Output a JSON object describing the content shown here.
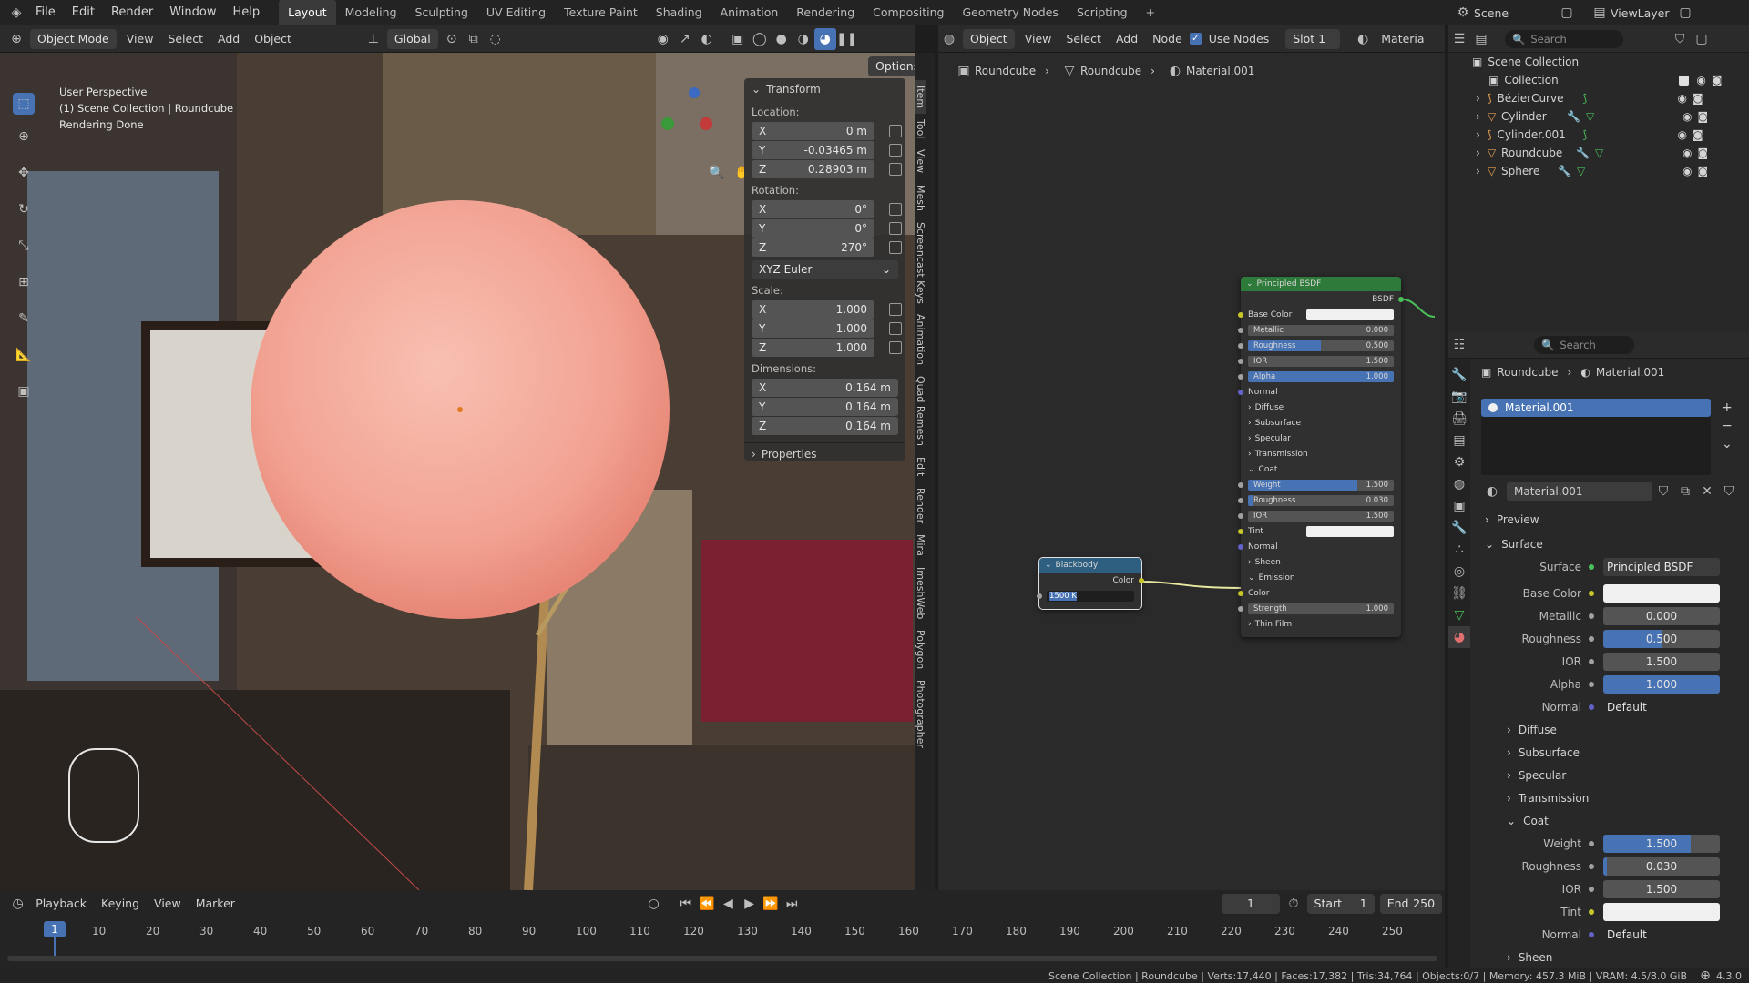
{
  "topbar": {
    "menus": [
      "File",
      "Edit",
      "Render",
      "Window",
      "Help"
    ],
    "workspaces": [
      "Layout",
      "Modeling",
      "Sculpting",
      "UV Editing",
      "Texture Paint",
      "Shading",
      "Animation",
      "Rendering",
      "Compositing",
      "Geometry Nodes",
      "Scripting"
    ],
    "active_workspace": "Layout",
    "scene": "Scene",
    "view_layer": "ViewLayer"
  },
  "viewport_header": {
    "mode": "Object Mode",
    "menus": [
      "View",
      "Select",
      "Add",
      "Object"
    ],
    "orientation": "Global",
    "options": "Options"
  },
  "viewport_overlay": {
    "line1": "User Perspective",
    "line2": "(1) Scene Collection | Roundcube",
    "line3": "Rendering Done"
  },
  "npanel": {
    "title": "Transform",
    "location_label": "Location:",
    "location": [
      {
        "axis": "X",
        "value": "0 m"
      },
      {
        "axis": "Y",
        "value": "-0.03465 m"
      },
      {
        "axis": "Z",
        "value": "0.28903 m"
      }
    ],
    "rotation_label": "Rotation:",
    "rotation": [
      {
        "axis": "X",
        "value": "0°"
      },
      {
        "axis": "Y",
        "value": "0°"
      },
      {
        "axis": "Z",
        "value": "-270°"
      }
    ],
    "rotation_mode": "XYZ Euler",
    "scale_label": "Scale:",
    "scale": [
      {
        "axis": "X",
        "value": "1.000"
      },
      {
        "axis": "Y",
        "value": "1.000"
      },
      {
        "axis": "Z",
        "value": "1.000"
      }
    ],
    "dimensions_label": "Dimensions:",
    "dimensions": [
      {
        "axis": "X",
        "value": "0.164 m"
      },
      {
        "axis": "Y",
        "value": "0.164 m"
      },
      {
        "axis": "Z",
        "value": "0.164 m"
      }
    ],
    "properties": "Properties",
    "tabs": [
      "Item",
      "Tool",
      "View",
      "Mesh",
      "Screencast Keys",
      "Animation",
      "Quad Remesh",
      "Edit",
      "Render",
      "Mira",
      "ImeshWeb",
      "Polygon",
      "Photographer"
    ]
  },
  "node_header": {
    "type": "Object",
    "menus": [
      "View",
      "Select",
      "Add",
      "Node"
    ],
    "use_nodes": "Use Nodes",
    "slot": "Slot 1",
    "material_trunc": "Materia",
    "breadcrumb": [
      "Roundcube",
      "Roundcube",
      "Material.001"
    ]
  },
  "bsdf_node": {
    "title": "Principled BSDF",
    "output": "BSDF",
    "base_color": "Base Color",
    "rows": [
      {
        "label": "Metallic",
        "value": "0.000",
        "fill": 0
      },
      {
        "label": "Roughness",
        "value": "0.500",
        "fill": 0.5
      },
      {
        "label": "IOR",
        "value": "1.500",
        "fill": 0
      },
      {
        "label": "Alpha",
        "value": "1.000",
        "fill": 1
      }
    ],
    "normal": "Normal",
    "sections": [
      "Diffuse",
      "Subsurface",
      "Specular",
      "Transmission"
    ],
    "coat": "Coat",
    "coat_rows": [
      {
        "label": "Weight",
        "value": "1.500",
        "fill": 0.75
      },
      {
        "label": "Roughness",
        "value": "0.030",
        "fill": 0
      },
      {
        "label": "IOR",
        "value": "1.500",
        "fill": 0
      }
    ],
    "tint": "Tint",
    "coat_normal": "Normal",
    "sheen": "Sheen",
    "emission": "Emission",
    "color": "Color",
    "strength": {
      "label": "Strength",
      "value": "1.000"
    },
    "thin_film": "Thin Film"
  },
  "blackbody_node": {
    "title": "Blackbody",
    "output": "Color",
    "input_value": "1500 K"
  },
  "outliner": {
    "search_placeholder": "Search",
    "root": "Scene Collection",
    "collection": "Collection",
    "items": [
      "BézierCurve",
      "Cylinder",
      "Cylinder.001",
      "Roundcube",
      "Sphere"
    ]
  },
  "properties": {
    "search_placeholder": "Search",
    "breadcrumb": [
      "Roundcube",
      "Material.001"
    ],
    "slot_name": "Material.001",
    "material_name": "Material.001",
    "preview": "Preview",
    "surface_section": "Surface",
    "surface_label": "Surface",
    "surface_value": "Principled BSDF",
    "rows": [
      {
        "label": "Base Color",
        "value": "",
        "kind": "color"
      },
      {
        "label": "Metallic",
        "value": "0.000",
        "fill": 0
      },
      {
        "label": "Roughness",
        "value": "0.500",
        "fill": 0.5
      },
      {
        "label": "IOR",
        "value": "1.500",
        "fill": 0
      },
      {
        "label": "Alpha",
        "value": "1.000",
        "fill": 1
      },
      {
        "label": "Normal",
        "value": "Default",
        "kind": "link"
      }
    ],
    "sections": [
      "Diffuse",
      "Subsurface",
      "Specular",
      "Transmission"
    ],
    "coat": "Coat",
    "coat_rows": [
      {
        "label": "Weight",
        "value": "1.500",
        "fill": 0.75
      },
      {
        "label": "Roughness",
        "value": "0.030",
        "fill": 0
      },
      {
        "label": "IOR",
        "value": "1.500",
        "fill": 0
      },
      {
        "label": "Tint",
        "value": "",
        "kind": "color"
      },
      {
        "label": "Normal",
        "value": "Default",
        "kind": "link"
      }
    ],
    "sheen": "Sheen"
  },
  "timeline": {
    "menus": [
      "Playback",
      "Keying",
      "View",
      "Marker"
    ],
    "current_frame": "1",
    "start_label": "Start",
    "start": "1",
    "end_label": "End",
    "end": "250",
    "ticks": [
      "10",
      "20",
      "30",
      "40",
      "50",
      "60",
      "70",
      "80",
      "90",
      "100",
      "110",
      "120",
      "130",
      "140",
      "150",
      "160",
      "170",
      "180",
      "190",
      "200",
      "210",
      "220",
      "230",
      "240",
      "250"
    ],
    "playhead": "1"
  },
  "statusbar": {
    "text": "Scene Collection | Roundcube | Verts:17,440 | Faces:17,382 | Tris:34,764 | Objects:0/7 | Memory: 457.3 MiB | VRAM: 4.5/8.0 GiB",
    "version": "4.3.0"
  },
  "colors": {
    "accent": "#4772b3",
    "sphere": "#f2a898",
    "node_header_green": "#2e7a3a",
    "node_header_blue": "#2f5f80"
  }
}
